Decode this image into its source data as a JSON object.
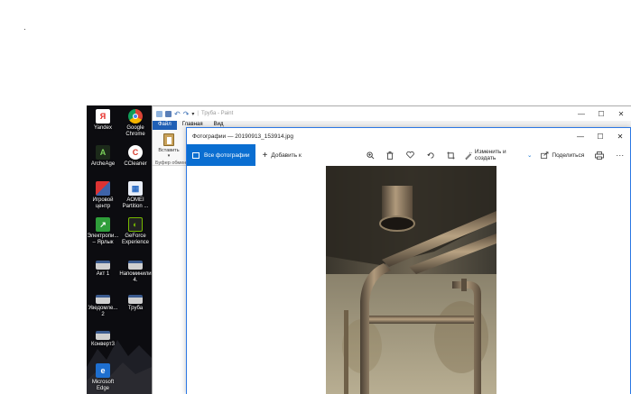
{
  "desktop": {
    "icons": [
      {
        "label": "Yandex",
        "icon": "yandex-icon",
        "color": "#e52620"
      },
      {
        "label": "Google Chrome",
        "icon": "chrome-icon",
        "color": "#db4437"
      },
      {
        "label": "ArcheAge",
        "icon": "archeage-icon",
        "color": "#3a7d2b"
      },
      {
        "label": "CCleaner",
        "icon": "ccleaner-icon",
        "color": "#d63b2d"
      },
      {
        "label": "Игровой центр",
        "icon": "game-center-icon",
        "color": "#3e63a8"
      },
      {
        "label": "AOMEI Partition ...",
        "icon": "aomei-icon",
        "color": "#2b6cc4"
      },
      {
        "label": "Электропи... – Ярлык",
        "icon": "shortcut-icon",
        "color": "#2f9e3a"
      },
      {
        "label": "GeForce Experience",
        "icon": "geforce-icon",
        "color": "#76b900"
      },
      {
        "label": "Акт 1",
        "icon": "document-icon",
        "color": "#cfcfcf"
      },
      {
        "label": "Напоминили 4.",
        "icon": "document-icon",
        "color": "#cfcfcf"
      },
      {
        "label": "Уведомле... 2",
        "icon": "document-icon",
        "color": "#cfcfcf"
      },
      {
        "label": "Труба",
        "icon": "document-icon",
        "color": "#cfcfcf"
      },
      {
        "label": "Конверт3",
        "icon": "document-icon",
        "color": "#cfcfcf"
      },
      {
        "label": "Microsoft Edge",
        "icon": "edge-icon",
        "color": "#1e6fd0"
      }
    ]
  },
  "paint": {
    "title": "Труба - Paint",
    "tabs": [
      "Файл",
      "Главная",
      "Вид"
    ],
    "paste_label": "Вставить",
    "clipboard_label": "Буфер обмен",
    "minimize": "—",
    "maximize": "☐",
    "close": "✕"
  },
  "photos": {
    "title": "Фотографии — 20190913_153914.jpg",
    "all_photos": "Все фотографии",
    "add_to": "Добавить к",
    "edit_create": "Изменить и создать",
    "share": "Поделиться",
    "more": "···",
    "minimize": "—",
    "maximize": "☐",
    "close": "✕",
    "accent": "#0a6ed1"
  }
}
